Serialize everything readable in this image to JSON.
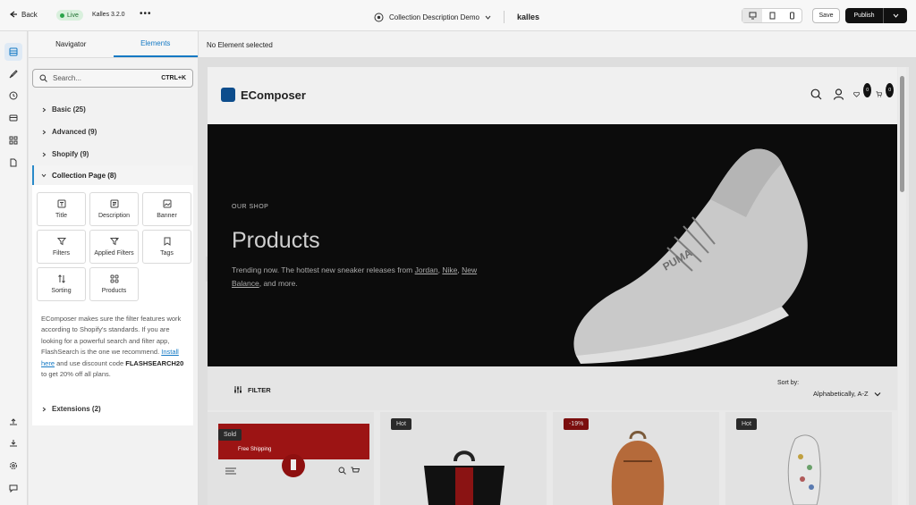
{
  "topbar": {
    "back_label": "Back",
    "live_label": "Live",
    "version": "Kalles 3.2.0",
    "more_icon": "more-dots-icon",
    "page_title": "Collection Description Demo",
    "theme_logo": "kalles",
    "devices": [
      "desktop-icon",
      "tablet-icon",
      "mobile-icon"
    ],
    "save_label": "Save",
    "publish_label": "Publish"
  },
  "rail": {
    "items": [
      "layers-icon",
      "brush-icon",
      "history-icon",
      "template-icon",
      "apps-icon",
      "page-icon"
    ],
    "bottom_items": [
      "upload-icon",
      "download-icon",
      "settings-icon",
      "chat-icon"
    ]
  },
  "panel": {
    "tabs": [
      "Navigator",
      "Elements"
    ],
    "active_tab": "Elements",
    "search_placeholder": "Search...",
    "search_shortcut": "CTRL+K",
    "categories": [
      {
        "label": "Basic (25)"
      },
      {
        "label": "Advanced (9)"
      },
      {
        "label": "Shopify (9)"
      }
    ],
    "open_category": "Collection Page (8)",
    "elements": [
      {
        "label": "Title",
        "icon": "title-icon"
      },
      {
        "label": "Description",
        "icon": "description-icon"
      },
      {
        "label": "Banner",
        "icon": "banner-icon"
      },
      {
        "label": "Filters",
        "icon": "filter-icon"
      },
      {
        "label": "Applied Filters",
        "icon": "applied-filters-icon"
      },
      {
        "label": "Tags",
        "icon": "tag-icon"
      },
      {
        "label": "Sorting",
        "icon": "sorting-icon"
      },
      {
        "label": "Products",
        "icon": "products-grid-icon"
      }
    ],
    "note_part1": "EComposer makes sure the filter features work according to Shopify's standards. If you are looking for a powerful search and filter app, FlashSearch is the one we recommend.",
    "note_link": "Install here",
    "note_part2": "and use discount code",
    "note_code": "FLASHSEARCH20",
    "note_part3": "to get 20% off all plans.",
    "extensions": "Extensions (2)"
  },
  "canvas": {
    "status": "No Element selected",
    "site": {
      "brand": "EComposer",
      "wishlist_count": "0",
      "cart_count": "0",
      "hero_eyebrow": "OUR SHOP",
      "hero_title": "Products",
      "hero_text_1": "Trending now. The hottest new sneaker releases from",
      "hero_link_1": "Jordan",
      "hero_link_2": "Nike",
      "hero_link_3": "New Balance",
      "hero_text_2": ", and more.",
      "filter_label": "FILTER",
      "sort_label": "Sort by:",
      "sort_value": "Alphabetically, A-Z",
      "products": [
        {
          "badge": "Sold",
          "banner": "Free Shipping"
        },
        {
          "badge": "Hot"
        },
        {
          "badge": "-19%"
        },
        {
          "badge": "Hot"
        }
      ]
    }
  }
}
